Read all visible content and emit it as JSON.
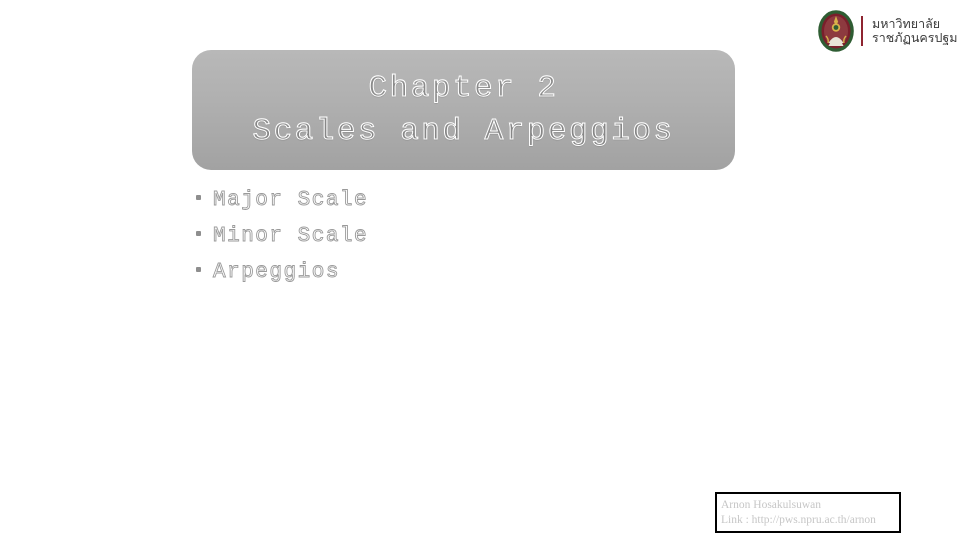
{
  "slide": {
    "background_color": "#ffffff",
    "title_panel": {
      "line1": "Chapter 2",
      "line2": "Scales and Arpeggios",
      "fill_top_color": "#b8b8b8",
      "fill_bottom_color": "#a2a2a2",
      "text_outline_color": "#ffffff"
    },
    "bullets": [
      {
        "label": "Major Scale"
      },
      {
        "label": "Minor Scale"
      },
      {
        "label": "Arpeggios"
      }
    ],
    "bullet_color": "#8e8e8e",
    "bullet_text_color": "#9a9a9a"
  },
  "logo": {
    "emblem_icon": "university-seal-icon",
    "divider_color": "#8e2430",
    "line1": "มหาวิทยาลัย",
    "line2": "ราชภัฏนครปฐม",
    "text_color": "#3b3b3b"
  },
  "credit": {
    "author": "Arnon Hosakulsuwan",
    "link": "Link : http://pws.npru.ac.th/arnon",
    "text_color": "#c6c6c6",
    "border_color": "#000000"
  }
}
